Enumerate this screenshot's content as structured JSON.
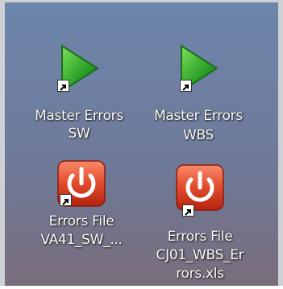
{
  "desktop": {
    "icons": [
      {
        "line1": "Master Errors",
        "line2": "SW",
        "line3": "",
        "icon": "green-play-icon"
      },
      {
        "line1": "Master Errors",
        "line2": "WBS",
        "line3": "",
        "icon": "green-play-icon"
      },
      {
        "line1": "Errors File",
        "line2": "VA41_SW_...",
        "line3": "",
        "icon": "red-power-icon"
      },
      {
        "line1": "Errors File",
        "line2": "CJ01_WBS_Er",
        "line3": "rors.xls",
        "icon": "red-power-icon"
      }
    ],
    "colors": {
      "play": "#2fa52a",
      "power": "#e24a2c"
    }
  }
}
